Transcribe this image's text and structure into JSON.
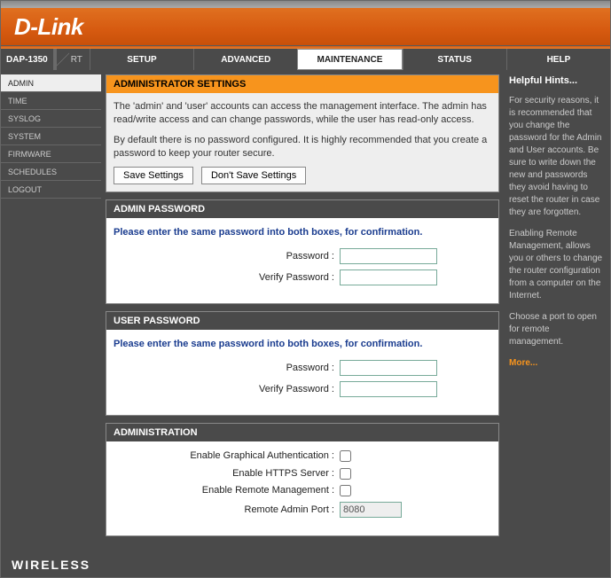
{
  "brand": "D-Link",
  "device": {
    "model": "DAP-1350",
    "mode": "RT"
  },
  "nav": {
    "tabs": [
      "SETUP",
      "ADVANCED",
      "MAINTENANCE",
      "STATUS",
      "HELP"
    ],
    "active": "MAINTENANCE"
  },
  "sidebar": {
    "items": [
      "ADMIN",
      "TIME",
      "SYSLOG",
      "SYSTEM",
      "FIRMWARE",
      "SCHEDULES",
      "LOGOUT"
    ],
    "active": "ADMIN"
  },
  "settings_panel": {
    "title": "ADMINISTRATOR SETTINGS",
    "desc1": "The 'admin' and 'user' accounts can access the management interface. The admin has read/write access and can change passwords, while the user has read-only access.",
    "desc2": "By default there is no password configured. It is highly recommended that you create a password to keep your router secure.",
    "save_label": "Save Settings",
    "dont_save_label": "Don't Save Settings"
  },
  "admin_pw": {
    "title": "ADMIN PASSWORD",
    "instr": "Please enter the same password into both boxes, for confirmation.",
    "password_label": "Password :",
    "verify_label": "Verify Password :",
    "password_value": "",
    "verify_value": ""
  },
  "user_pw": {
    "title": "USER PASSWORD",
    "instr": "Please enter the same password into both boxes, for confirmation.",
    "password_label": "Password :",
    "verify_label": "Verify Password :",
    "password_value": "",
    "verify_value": ""
  },
  "administration": {
    "title": "ADMINISTRATION",
    "graphical_label": "Enable Graphical Authentication :",
    "https_label": "Enable HTTPS Server :",
    "remote_label": "Enable Remote Management :",
    "port_label": "Remote Admin Port :",
    "graphical_checked": false,
    "https_checked": false,
    "remote_checked": false,
    "port_value": "8080"
  },
  "help": {
    "title": "Helpful Hints...",
    "para1": "For security reasons, it is recommended that you change the password for the Admin and User accounts. Be sure to write down the new and passwords they avoid having to reset the router in case they are forgotten.",
    "para2": "Enabling Remote Management, allows you or others to change the router configuration from a computer on the Internet.",
    "para3": "Choose a port to open for remote management.",
    "more": "More..."
  },
  "footer": "WIRELESS"
}
